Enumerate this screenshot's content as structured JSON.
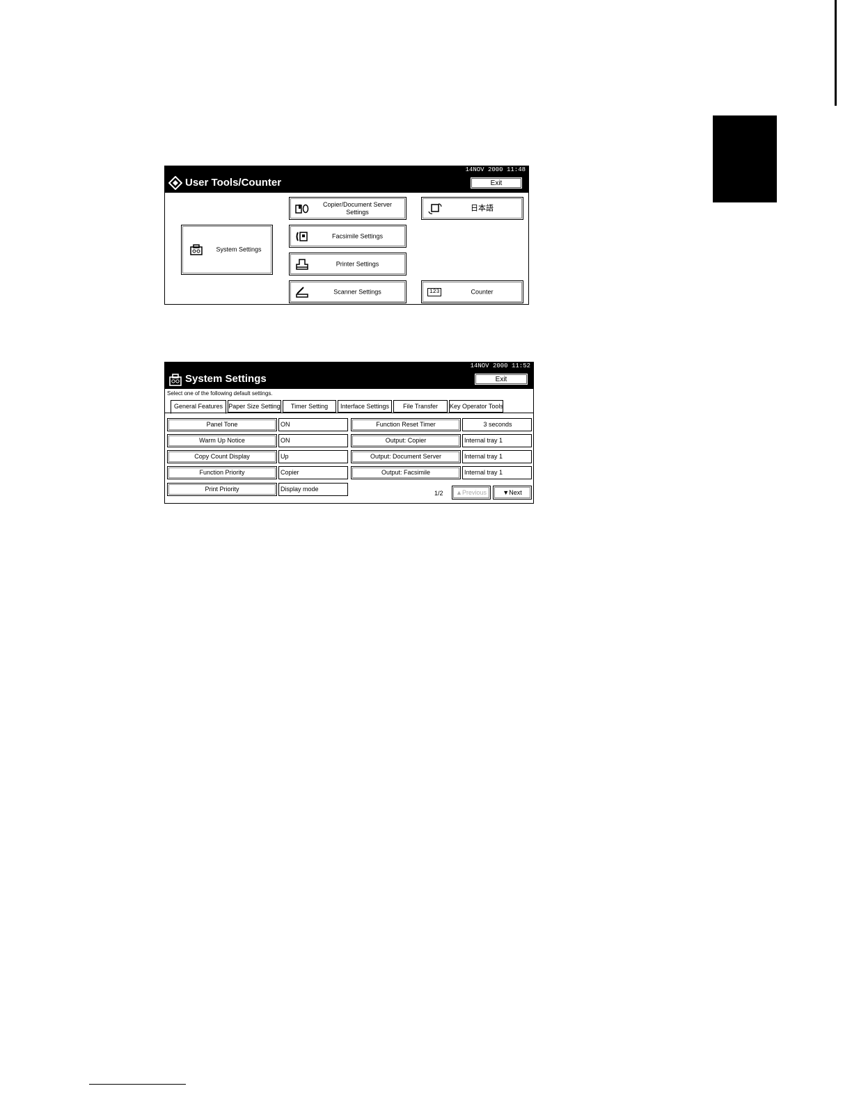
{
  "screen1": {
    "datetime": "14NOV  2000  11:48",
    "title": "User Tools/Counter",
    "exit_label": "Exit",
    "system_settings": "System Settings",
    "copier_settings": "Copier/Document Server Settings",
    "facsimile_settings": "Facsimile Settings",
    "printer_settings": "Printer Settings",
    "scanner_settings": "Scanner Settings",
    "language": "日本語",
    "counter": "Counter",
    "counter_icon_text": "123"
  },
  "screen2": {
    "datetime": "14NOV  2000  11:52",
    "title": "System Settings",
    "exit_label": "Exit",
    "hint": "Select one of the following default settings.",
    "tabs": [
      "General Features",
      "Paper Size Setting",
      "Timer Setting",
      "Interface Settings",
      "File Transfer",
      "Key Operator Tools"
    ],
    "left_rows": [
      {
        "label": "Panel Tone",
        "value": "ON"
      },
      {
        "label": "Warm Up Notice",
        "value": "ON"
      },
      {
        "label": "Copy Count Display",
        "value": "Up"
      },
      {
        "label": "Function Priority",
        "value": "Copier"
      },
      {
        "label": "Print Priority",
        "value": "Display mode"
      }
    ],
    "right_rows": [
      {
        "label": "Function Reset Timer",
        "value": "3  seconds"
      },
      {
        "label": "Output: Copier",
        "value": "Internal tray 1"
      },
      {
        "label": "Output: Document Server",
        "value": "Internal tray 1"
      },
      {
        "label": "Output: Facsimile",
        "value": "Internal tray 1"
      }
    ],
    "page": "1/2",
    "previous_label": "▲Previous",
    "next_label": "▼Next"
  }
}
